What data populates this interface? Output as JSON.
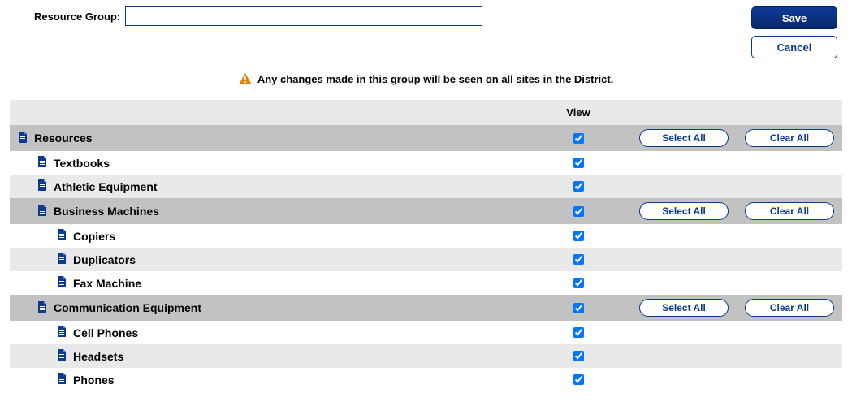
{
  "header": {
    "label": "Resource Group:",
    "value": ""
  },
  "actions": {
    "save": "Save",
    "cancel": "Cancel"
  },
  "warning": "Any changes made in this group will be seen on all sites in the District.",
  "columns": {
    "view": "View"
  },
  "buttons": {
    "select_all": "Select All",
    "clear_all": "Clear All"
  },
  "rows": [
    {
      "label": "Resources",
      "indent": 0,
      "checked": true,
      "category": true
    },
    {
      "label": "Textbooks",
      "indent": 1,
      "checked": true,
      "category": false
    },
    {
      "label": "Athletic Equipment",
      "indent": 1,
      "checked": true,
      "category": false
    },
    {
      "label": "Business Machines",
      "indent": 1,
      "checked": true,
      "category": true
    },
    {
      "label": "Copiers",
      "indent": 2,
      "checked": true,
      "category": false
    },
    {
      "label": "Duplicators",
      "indent": 2,
      "checked": true,
      "category": false
    },
    {
      "label": "Fax Machine",
      "indent": 2,
      "checked": true,
      "category": false
    },
    {
      "label": "Communication Equipment",
      "indent": 1,
      "checked": true,
      "category": true
    },
    {
      "label": "Cell Phones",
      "indent": 2,
      "checked": true,
      "category": false
    },
    {
      "label": "Headsets",
      "indent": 2,
      "checked": true,
      "category": false
    },
    {
      "label": "Phones",
      "indent": 2,
      "checked": true,
      "category": false
    }
  ]
}
